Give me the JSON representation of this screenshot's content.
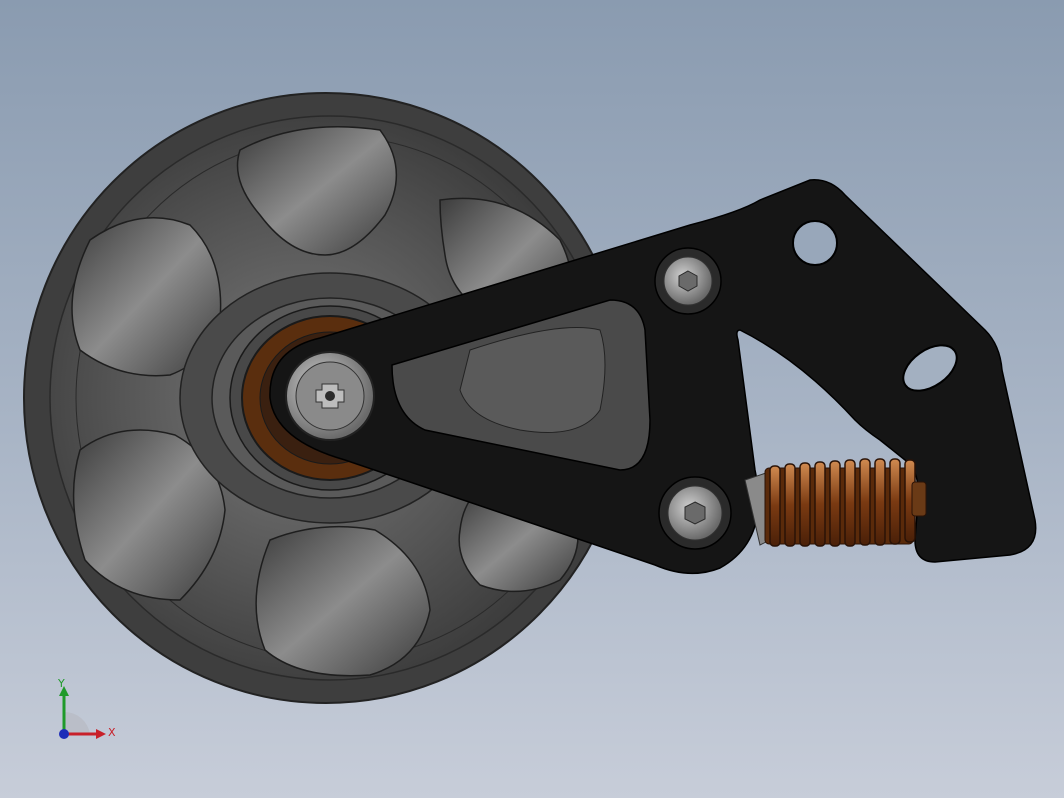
{
  "viewport": {
    "background_top": "#8a9bb0",
    "background_bottom": "#c7cdd9"
  },
  "model": {
    "pulley_color": "#4a4a4a",
    "bracket_color": "#151515",
    "bearing_color": "#5a2e0e",
    "spring_color": "#8a4a1c"
  },
  "triad": {
    "x_label": "X",
    "y_label": "Y",
    "x_color": "#c8202a",
    "y_color": "#1f9a2a",
    "z_color": "#1c2cb8"
  }
}
